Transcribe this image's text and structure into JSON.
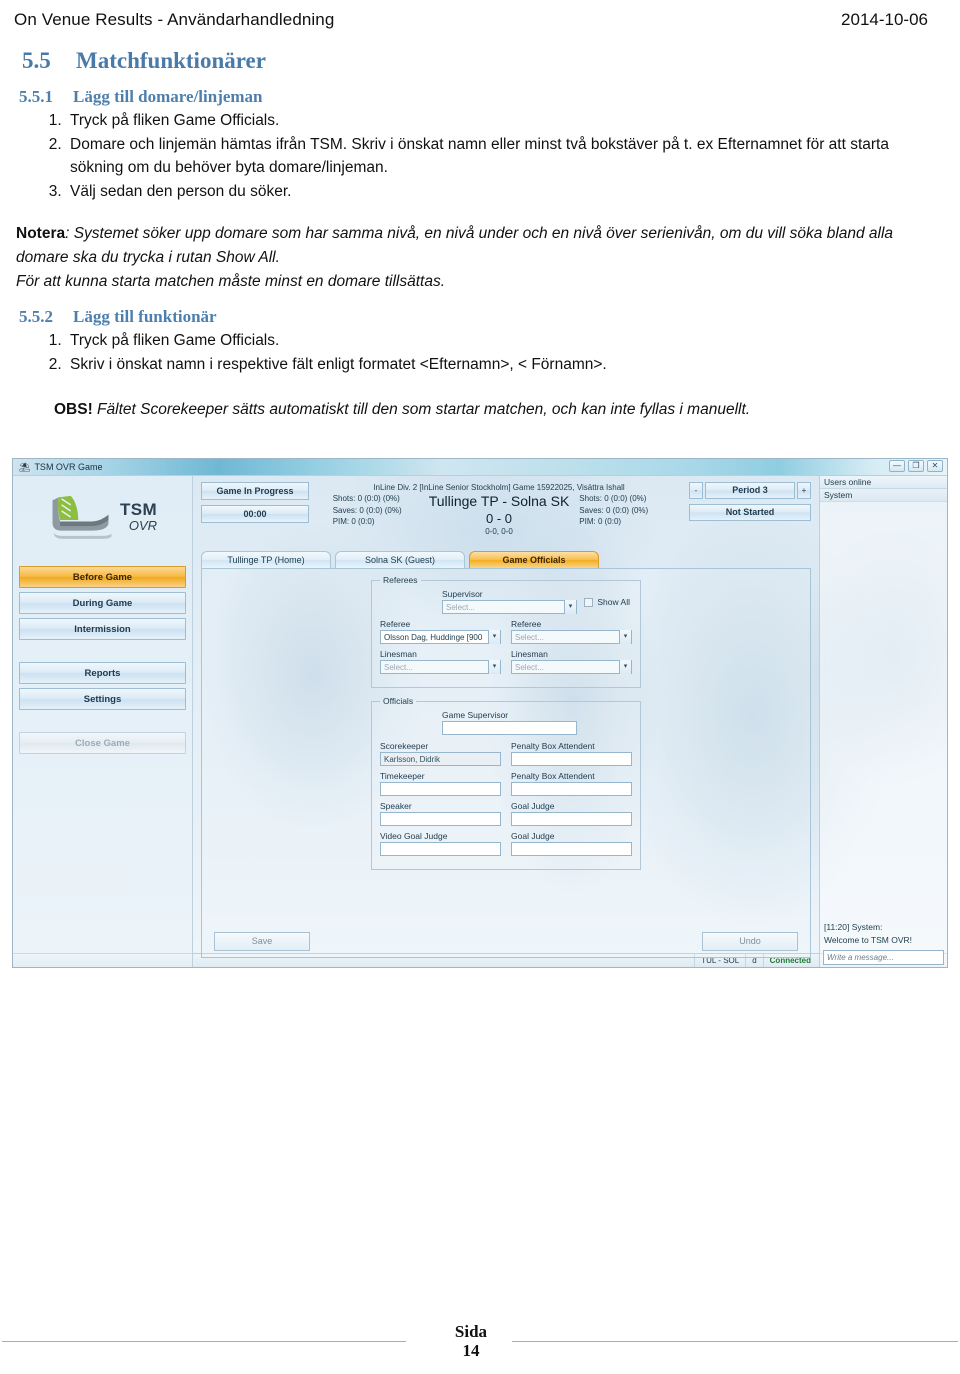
{
  "document": {
    "header": {
      "title": "On Venue Results - Användarhandledning",
      "date": "2014-10-06"
    },
    "section_5_5": {
      "number": "5.5",
      "title": "Matchfunktionärer"
    },
    "section_5_5_1": {
      "number": "5.5.1",
      "title": "Lägg till domare/linjeman",
      "steps": [
        "Tryck på fliken Game Officials.",
        "Domare och linjemän hämtas ifrån TSM. Skriv i önskat namn eller minst två bokstäver på t. ex Efternamnet för att starta sökning om du behöver byta domare/linjeman.",
        "Välj sedan den person du söker."
      ]
    },
    "note": {
      "label": "Notera",
      "text": ": Systemet söker upp domare som har samma nivå, en nivå under och en nivå över serienivån, om du vill söka bland alla domare ska du trycka i rutan Show All.",
      "line2": "För att kunna starta matchen måste minst en domare tillsättas."
    },
    "section_5_5_2": {
      "number": "5.5.2",
      "title": "Lägg till funktionär",
      "steps": [
        "Tryck på fliken Game Officials.",
        "Skriv i önskat namn i respektive fält enligt formatet <Efternamn>, < Förnamn>."
      ]
    },
    "obs": {
      "label": "OBS!",
      "text": " Fältet Scorekeeper sätts automatiskt till den som startar matchen, och kan inte fyllas i manuellt."
    },
    "footer": {
      "page_label": "Sida",
      "page_number": "14"
    }
  },
  "app": {
    "window": {
      "title": "TSM OVR Game",
      "icon": "skate-icon",
      "minimize": "—",
      "restore": "❐",
      "close": "✕"
    },
    "logo": {
      "line1": "TSM",
      "line2": "OVR"
    },
    "sidebar": {
      "items": [
        {
          "label": "Before Game",
          "state": "active"
        },
        {
          "label": "During Game",
          "state": "normal"
        },
        {
          "label": "Intermission",
          "state": "normal"
        },
        {
          "label": "Reports",
          "state": "normal"
        },
        {
          "label": "Settings",
          "state": "normal"
        },
        {
          "label": "Close Game",
          "state": "disabled"
        }
      ]
    },
    "state_buttons": {
      "progress": "Game In Progress",
      "clock": "00:00"
    },
    "scoreboard": {
      "game_info": "InLine Div. 2 [InLine Senior Stockholm] Game 15922025, Visättra Ishall",
      "home_stats": [
        "Shots: 0 (0:0) (0%)",
        "Saves: 0 (0:0) (0%)",
        "PIM: 0 (0:0)"
      ],
      "guest_stats": [
        "Shots: 0 (0:0) (0%)",
        "Saves: 0 (0:0) (0%)",
        "PIM: 0 (0:0)"
      ],
      "teams": "Tullinge TP  -  Solna SK",
      "score": "0 - 0",
      "periods": "0-0, 0-0"
    },
    "period_control": {
      "minus": "-",
      "plus": "+",
      "period": "Period 3",
      "status": "Not Started"
    },
    "tabs": [
      {
        "label": "Tullinge TP  (Home)",
        "active": false
      },
      {
        "label": "Solna SK (Guest)",
        "active": false
      },
      {
        "label": "Game Officials",
        "active": true
      }
    ],
    "referees_group": {
      "legend": "Referees",
      "supervisor_label": "Supervisor",
      "supervisor_value": "Select...",
      "show_all_label": "Show All",
      "referee_left_label": "Referee",
      "referee_left_value": "Olsson Dag, Huddinge [900",
      "referee_right_label": "Referee",
      "referee_right_value": "Select...",
      "linesman_left_label": "Linesman",
      "linesman_left_value": "Select...",
      "linesman_right_label": "Linesman",
      "linesman_right_value": "Select..."
    },
    "officials_group": {
      "legend": "Officials",
      "game_supervisor_label": "Game Supervisor",
      "game_supervisor_value": "",
      "scorekeeper_label": "Scorekeeper",
      "scorekeeper_value": "Karlsson, Didrik",
      "penalty_box_1_label": "Penalty Box Attendent",
      "penalty_box_1_value": "",
      "timekeeper_label": "Timekeeper",
      "timekeeper_value": "",
      "penalty_box_2_label": "Penalty Box Attendent",
      "penalty_box_2_value": "",
      "speaker_label": "Speaker",
      "speaker_value": "",
      "goal_judge_1_label": "Goal Judge",
      "goal_judge_1_value": "",
      "video_goal_judge_label": "Video Goal Judge",
      "video_goal_judge_value": "",
      "goal_judge_2_label": "Goal Judge",
      "goal_judge_2_value": ""
    },
    "actions": {
      "save": "Save",
      "undo": "Undo"
    },
    "right_panel": {
      "users_header": "Users online",
      "users": [
        "System"
      ],
      "chat_message": "[11:20] System:\nWelcome to TSM OVR!",
      "chat_placeholder": "Write a message..."
    },
    "status_bar": {
      "match": "TUL - SOL",
      "flag": "d",
      "connection": "Connected",
      "connection_color": "#1f7a33"
    }
  }
}
